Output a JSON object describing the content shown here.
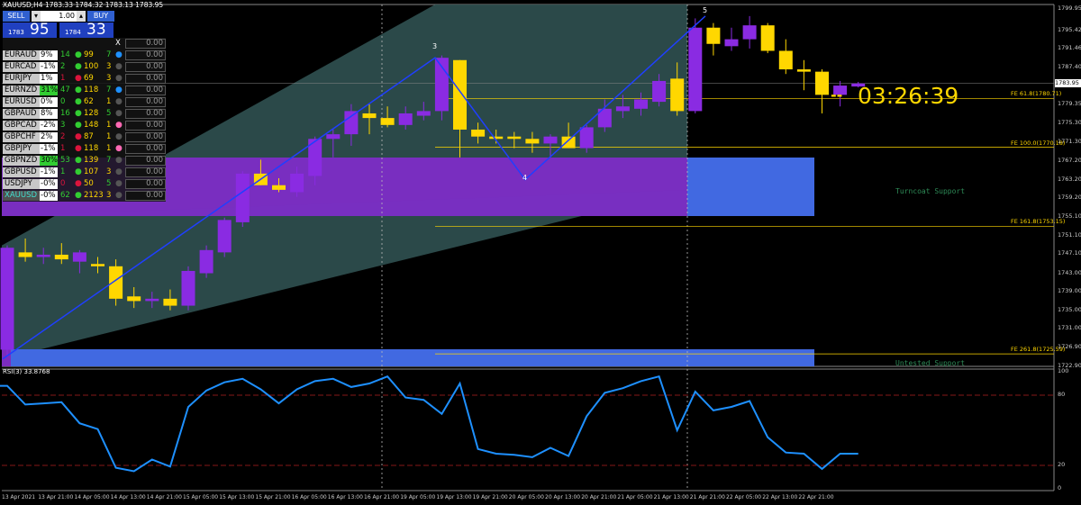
{
  "header": {
    "symbol_info": "XAUUSD,H4  1783.33 1784.32 1783.13 1783.95"
  },
  "trade_panel": {
    "sell_label": "SELL",
    "buy_label": "BUY",
    "lot": "1.00",
    "sell_price_small": "1783",
    "sell_price_big": "95",
    "buy_price_small": "1784",
    "buy_price_big": "33"
  },
  "symbols": [
    {
      "name": "",
      "pct": "",
      "a": "",
      "dot_color": "",
      "b": "",
      "c": "",
      "d_color": "",
      "close": "X",
      "val": "0.00"
    },
    {
      "name": "EURAUD",
      "pct": "9%",
      "a": "14",
      "dot_color": "#32cd32",
      "b": "99",
      "c": "7",
      "c_color": "#32cd32",
      "d_color": "#1e90ff",
      "val": "0.00"
    },
    {
      "name": "EURCAD",
      "pct": "-1%",
      "a": "2",
      "dot_color": "#32cd32",
      "b": "100",
      "c": "3",
      "c_color": "#ffd700",
      "d_color": "#555",
      "val": "0.00"
    },
    {
      "name": "EURJPY",
      "pct": "1%",
      "a": "1",
      "dot_color": "#dc143c",
      "b": "69",
      "c": "3",
      "c_color": "#ffd700",
      "d_color": "#555",
      "val": "0.00"
    },
    {
      "name": "EURNZD",
      "pct": "31%",
      "a": "47",
      "dot_color": "#32cd32",
      "b": "118",
      "c": "7",
      "c_color": "#32cd32",
      "d_color": "#1e90ff",
      "val": "0.00"
    },
    {
      "name": "EURUSD",
      "pct": "0%",
      "a": "0",
      "dot_color": "#32cd32",
      "b": "62",
      "c": "1",
      "c_color": "#ffd700",
      "d_color": "#555",
      "val": "0.00"
    },
    {
      "name": "GBPAUD",
      "pct": "8%",
      "a": "16",
      "dot_color": "#32cd32",
      "b": "128",
      "c": "5",
      "c_color": "#32cd32",
      "d_color": "#555",
      "val": "0.00"
    },
    {
      "name": "GBPCAD",
      "pct": "-2%",
      "a": "3",
      "dot_color": "#32cd32",
      "b": "148",
      "c": "1",
      "c_color": "#ffd700",
      "d_color": "#ff69b4",
      "val": "0.00"
    },
    {
      "name": "GBPCHF",
      "pct": "2%",
      "a": "2",
      "dot_color": "#dc143c",
      "b": "87",
      "c": "1",
      "c_color": "#ffd700",
      "d_color": "#555",
      "val": "0.00"
    },
    {
      "name": "GBPJPY",
      "pct": "-1%",
      "a": "1",
      "dot_color": "#dc143c",
      "b": "118",
      "c": "1",
      "c_color": "#ffd700",
      "d_color": "#ff69b4",
      "val": "0.00"
    },
    {
      "name": "GBPNZD",
      "pct": "30%",
      "a": "53",
      "dot_color": "#32cd32",
      "b": "139",
      "c": "7",
      "c_color": "#32cd32",
      "d_color": "#555",
      "val": "0.00"
    },
    {
      "name": "GBPUSD",
      "pct": "-1%",
      "a": "1",
      "dot_color": "#32cd32",
      "b": "107",
      "c": "3",
      "c_color": "#ffd700",
      "d_color": "#555",
      "val": "0.00"
    },
    {
      "name": "USDJPY",
      "pct": "-0%",
      "a": "0",
      "dot_color": "#dc143c",
      "b": "50",
      "c": "5",
      "c_color": "#32cd32",
      "d_color": "#555",
      "val": "0.00"
    },
    {
      "name": "XAUUSD",
      "pct": "-0%",
      "a": "62",
      "dot_color": "#32cd32",
      "b": "2123",
      "c": "3",
      "c_color": "#ffd700",
      "d_color": "#555",
      "val": "0.00",
      "highlight": true
    }
  ],
  "timer": "03:26:39",
  "timer_marker": "--",
  "zones": {
    "turncoat": "Turncoat Support",
    "untested": "Untested Support"
  },
  "wave_labels": [
    "3",
    "4",
    "5"
  ],
  "fe_levels": [
    {
      "label": "FE 61.8(1780.71)",
      "price": 1780.71
    },
    {
      "label": "FE 100.0(1770.18)",
      "price": 1770.18
    },
    {
      "label": "FE 161.8(1753.15)",
      "price": 1753.15
    },
    {
      "label": "FE 261.8(1725.59)",
      "price": 1725.59
    }
  ],
  "price_axis": [
    "1799.95",
    "1795.42",
    "1791.46",
    "1787.40",
    "1783.95",
    "1779.35",
    "1775.30",
    "1771.30",
    "1767.20",
    "1763.20",
    "1759.20",
    "1755.10",
    "1751.10",
    "1747.10",
    "1743.00",
    "1739.00",
    "1735.00",
    "1731.00",
    "1726.90",
    "1722.90"
  ],
  "current_price": "1783.95",
  "rsi": {
    "label": "RSI(3) 33.8768",
    "levels": [
      "100",
      "80",
      "20",
      "0"
    ]
  },
  "time_axis": [
    "13 Apr 2021",
    "13 Apr 21:00",
    "14 Apr 05:00",
    "14 Apr 13:00",
    "14 Apr 21:00",
    "15 Apr 05:00",
    "15 Apr 13:00",
    "15 Apr 21:00",
    "16 Apr 05:00",
    "16 Apr 13:00",
    "16 Apr 21:00",
    "19 Apr 05:00",
    "19 Apr 13:00",
    "19 Apr 21:00",
    "20 Apr 05:00",
    "20 Apr 13:00",
    "20 Apr 21:00",
    "21 Apr 05:00",
    "21 Apr 13:00",
    "21 Apr 21:00",
    "22 Apr 05:00",
    "22 Apr 13:00",
    "22 Apr 21:00"
  ],
  "chart_data": {
    "type": "candlestick",
    "title": "XAUUSD,H4",
    "ylim": [
      1722.9,
      1801.0
    ],
    "colors": {
      "bull": "#8a2be2",
      "bear": "#ffd700"
    },
    "candles": [
      {
        "o": 1726.5,
        "h": 1749.0,
        "l": 1725.0,
        "c": 1748.5
      },
      {
        "o": 1747.5,
        "h": 1750.5,
        "l": 1745.5,
        "c": 1746.5
      },
      {
        "o": 1746.5,
        "h": 1748.5,
        "l": 1745.0,
        "c": 1747.0
      },
      {
        "o": 1747.0,
        "h": 1749.5,
        "l": 1745.0,
        "c": 1746.0
      },
      {
        "o": 1745.5,
        "h": 1748.0,
        "l": 1743.0,
        "c": 1747.5
      },
      {
        "o": 1745.0,
        "h": 1746.5,
        "l": 1743.0,
        "c": 1744.5
      },
      {
        "o": 1744.5,
        "h": 1746.0,
        "l": 1736.0,
        "c": 1737.5
      },
      {
        "o": 1738.0,
        "h": 1740.0,
        "l": 1735.5,
        "c": 1737.0
      },
      {
        "o": 1737.0,
        "h": 1739.0,
        "l": 1735.5,
        "c": 1737.5
      },
      {
        "o": 1737.5,
        "h": 1739.5,
        "l": 1735.0,
        "c": 1736.0
      },
      {
        "o": 1736.0,
        "h": 1744.5,
        "l": 1735.0,
        "c": 1743.5
      },
      {
        "o": 1743.0,
        "h": 1749.0,
        "l": 1742.0,
        "c": 1748.0
      },
      {
        "o": 1747.5,
        "h": 1755.0,
        "l": 1746.5,
        "c": 1754.5
      },
      {
        "o": 1754.0,
        "h": 1765.0,
        "l": 1753.0,
        "c": 1764.5
      },
      {
        "o": 1764.5,
        "h": 1767.5,
        "l": 1762.0,
        "c": 1762.0
      },
      {
        "o": 1762.0,
        "h": 1763.5,
        "l": 1760.5,
        "c": 1761.0
      },
      {
        "o": 1760.5,
        "h": 1766.0,
        "l": 1759.5,
        "c": 1764.5
      },
      {
        "o": 1764.0,
        "h": 1772.5,
        "l": 1762.0,
        "c": 1772.0
      },
      {
        "o": 1772.0,
        "h": 1774.0,
        "l": 1768.0,
        "c": 1773.0
      },
      {
        "o": 1773.0,
        "h": 1779.5,
        "l": 1770.5,
        "c": 1778.0
      },
      {
        "o": 1777.5,
        "h": 1779.5,
        "l": 1773.0,
        "c": 1776.5
      },
      {
        "o": 1776.5,
        "h": 1779.0,
        "l": 1774.5,
        "c": 1775.0
      },
      {
        "o": 1775.0,
        "h": 1779.0,
        "l": 1774.0,
        "c": 1777.5
      },
      {
        "o": 1777.0,
        "h": 1780.0,
        "l": 1776.0,
        "c": 1778.0
      },
      {
        "o": 1778.0,
        "h": 1790.0,
        "l": 1776.0,
        "c": 1789.5
      },
      {
        "o": 1789.0,
        "h": 1789.0,
        "l": 1768.0,
        "c": 1774.0
      },
      {
        "o": 1774.0,
        "h": 1775.5,
        "l": 1771.0,
        "c": 1772.5
      },
      {
        "o": 1772.5,
        "h": 1774.0,
        "l": 1771.0,
        "c": 1772.0
      },
      {
        "o": 1772.5,
        "h": 1773.5,
        "l": 1770.0,
        "c": 1772.0
      },
      {
        "o": 1772.0,
        "h": 1773.5,
        "l": 1769.0,
        "c": 1771.0
      },
      {
        "o": 1771.0,
        "h": 1773.0,
        "l": 1768.0,
        "c": 1772.5
      },
      {
        "o": 1772.5,
        "h": 1775.5,
        "l": 1770.0,
        "c": 1770.0
      },
      {
        "o": 1770.0,
        "h": 1775.0,
        "l": 1769.0,
        "c": 1774.5
      },
      {
        "o": 1774.5,
        "h": 1780.5,
        "l": 1773.5,
        "c": 1778.5
      },
      {
        "o": 1778.0,
        "h": 1781.5,
        "l": 1776.5,
        "c": 1779.0
      },
      {
        "o": 1778.5,
        "h": 1782.0,
        "l": 1777.0,
        "c": 1780.5
      },
      {
        "o": 1780.0,
        "h": 1786.0,
        "l": 1779.0,
        "c": 1784.5
      },
      {
        "o": 1785.0,
        "h": 1788.5,
        "l": 1777.0,
        "c": 1778.0
      },
      {
        "o": 1778.0,
        "h": 1798.0,
        "l": 1777.5,
        "c": 1796.0
      },
      {
        "o": 1796.0,
        "h": 1797.0,
        "l": 1790.0,
        "c": 1792.5
      },
      {
        "o": 1792.0,
        "h": 1796.0,
        "l": 1791.0,
        "c": 1793.5
      },
      {
        "o": 1793.5,
        "h": 1798.5,
        "l": 1791.5,
        "c": 1796.5
      },
      {
        "o": 1796.5,
        "h": 1797.0,
        "l": 1790.5,
        "c": 1791.0
      },
      {
        "o": 1791.0,
        "h": 1793.5,
        "l": 1786.0,
        "c": 1787.0
      },
      {
        "o": 1787.0,
        "h": 1789.0,
        "l": 1782.5,
        "c": 1786.5
      },
      {
        "o": 1786.5,
        "h": 1787.0,
        "l": 1777.5,
        "c": 1781.5
      },
      {
        "o": 1781.5,
        "h": 1784.5,
        "l": 1779.0,
        "c": 1783.5
      },
      {
        "o": 1783.3,
        "h": 1784.3,
        "l": 1783.1,
        "c": 1783.95
      }
    ],
    "rsi": [
      88,
      72,
      73,
      74,
      56,
      51,
      18,
      15,
      25,
      19,
      70,
      84,
      91,
      94,
      85,
      73,
      85,
      92,
      94,
      87,
      90,
      96,
      78,
      76,
      64,
      90,
      34,
      30,
      29,
      27,
      35,
      28,
      62,
      82,
      86,
      92,
      96,
      50,
      83,
      67,
      70,
      75,
      44,
      31,
      30,
      17,
      30,
      30
    ]
  }
}
